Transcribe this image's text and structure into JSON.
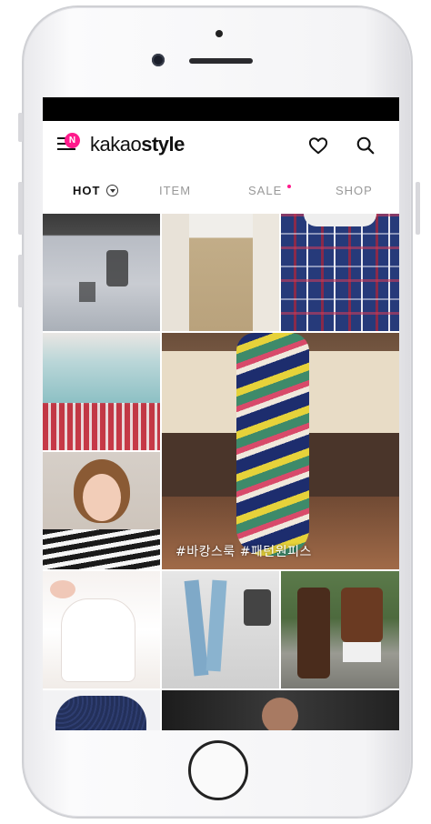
{
  "header": {
    "menu_badge": "N",
    "logo_regular": "kakao",
    "logo_bold": "style"
  },
  "tabs": [
    {
      "label": "HOT"
    },
    {
      "label": "ITEM"
    },
    {
      "label": "SALE"
    },
    {
      "label": "SHOP"
    }
  ],
  "feature_tile": {
    "hashtags": "#바캉스룩  #패턴원피스"
  },
  "colors": {
    "accent": "#ff1a8c",
    "status_bar": "#000000"
  },
  "icons": [
    "menu-icon",
    "heart-icon",
    "search-icon",
    "chevron-down-icon"
  ]
}
